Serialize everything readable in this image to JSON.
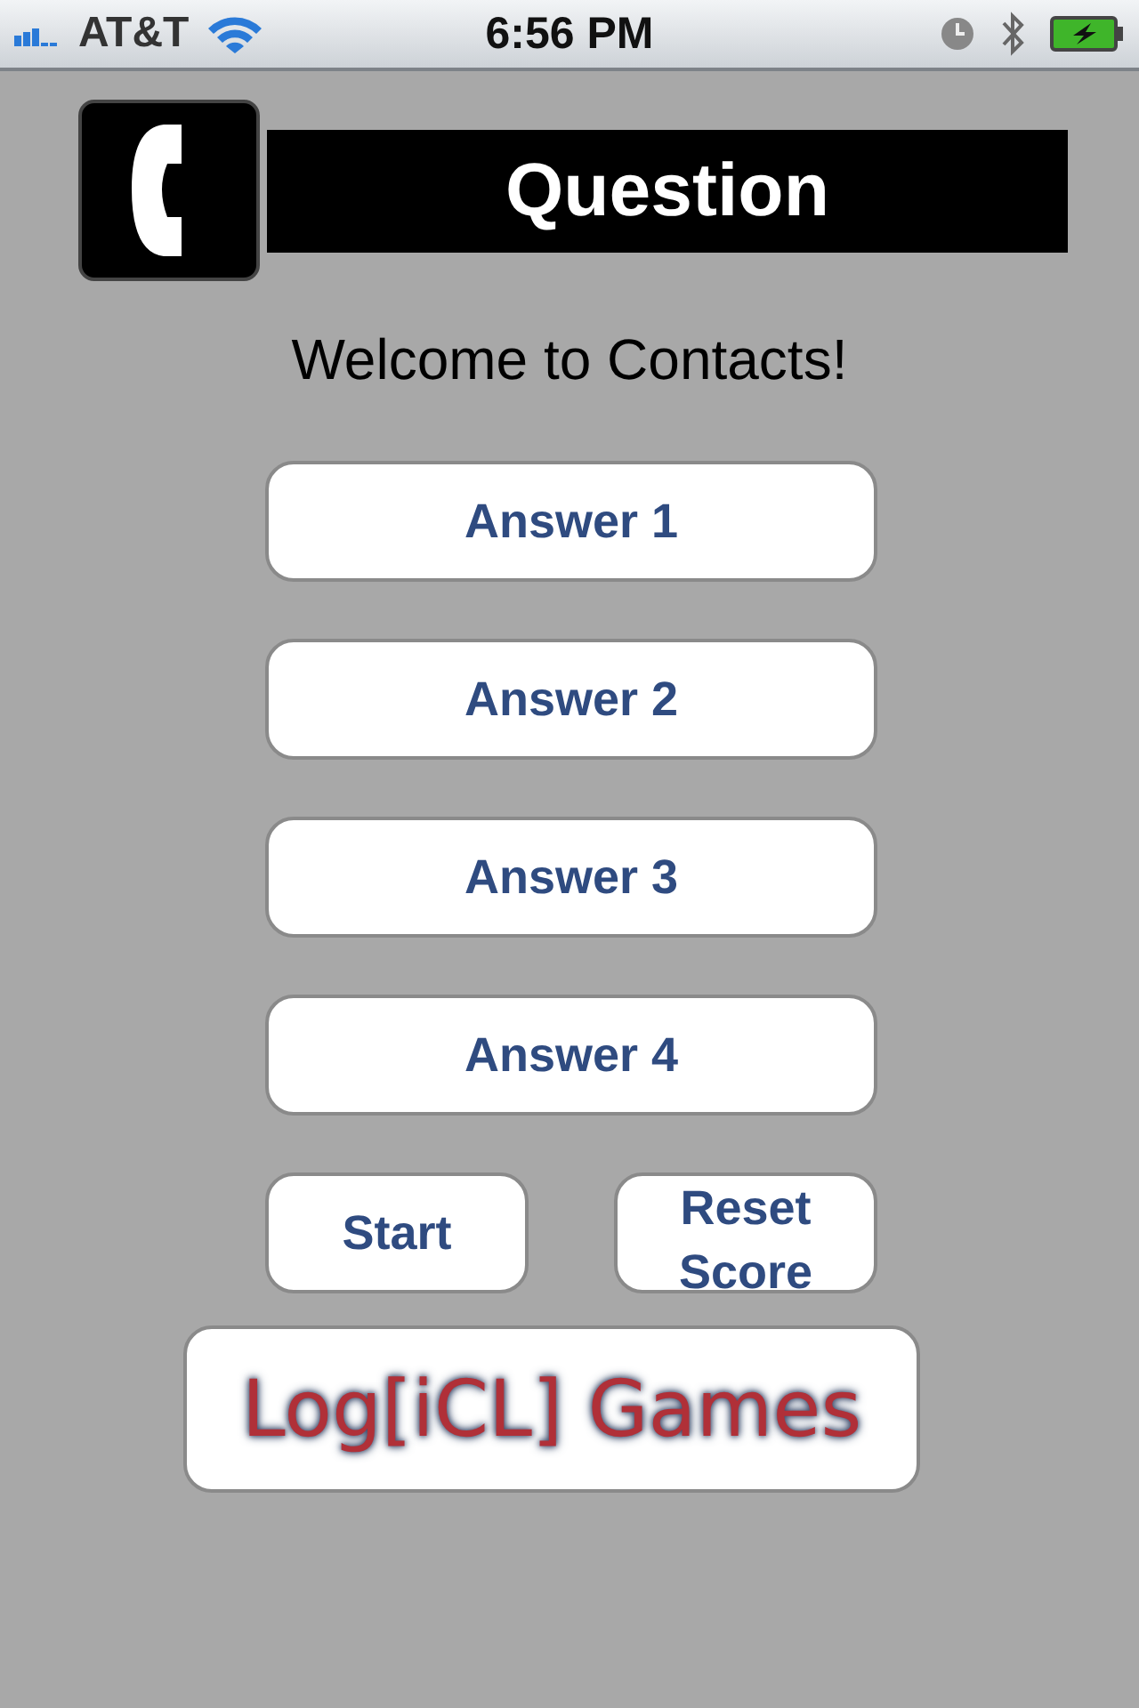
{
  "status_bar": {
    "carrier": "AT&T",
    "time": "6:56 PM"
  },
  "header": {
    "title": "Question"
  },
  "welcome": "Welcome to Contacts!",
  "answers": [
    "Answer 1",
    "Answer 2",
    "Answer 3",
    "Answer 4"
  ],
  "buttons": [
    "Start",
    "Reset Score"
  ],
  "logo": "Log[iCL] Games"
}
